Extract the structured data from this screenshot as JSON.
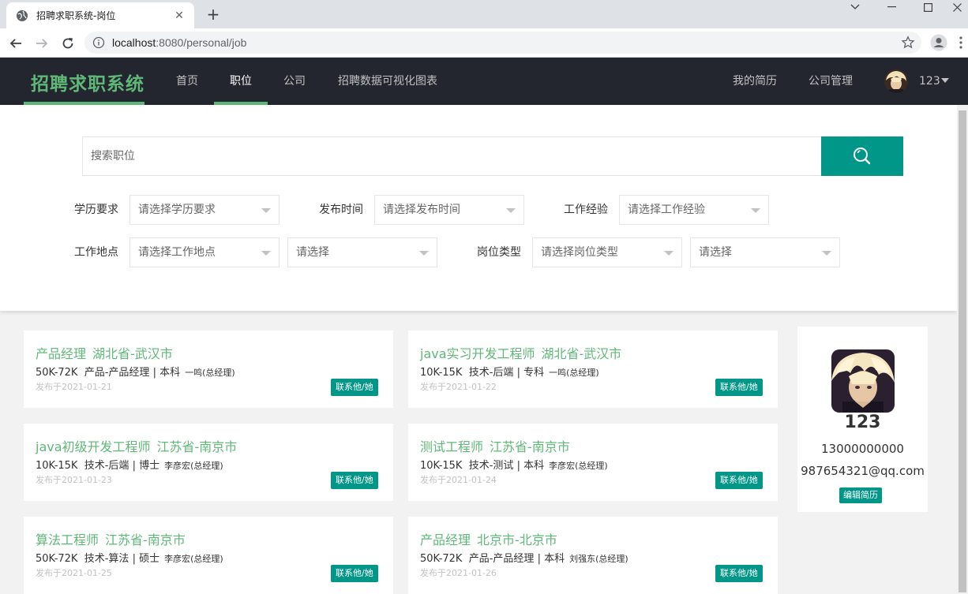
{
  "browser": {
    "tab_title": "招聘求职系统-岗位",
    "tab_close": "✕",
    "new_tab": "+",
    "url_host": "localhost",
    "url_rest": ":8080/personal/job"
  },
  "header": {
    "logo": "招聘求职系统",
    "nav": [
      "首页",
      "职位",
      "公司",
      "招聘数据可视化图表"
    ],
    "active_nav": "职位",
    "my_resume": "我的简历",
    "company_admin": "公司管理",
    "username": "123"
  },
  "search": {
    "placeholder": "搜索职位",
    "filters": {
      "education_label": "学历要求",
      "education_placeholder": "请选择学历要求",
      "publish_time_label": "发布时间",
      "publish_time_placeholder": "请选择发布时间",
      "experience_label": "工作经验",
      "experience_placeholder": "请选择工作经验",
      "location_label": "工作地点",
      "location_placeholder": "请选择工作地点",
      "location_sub_placeholder": "请选择",
      "job_type_label": "岗位类型",
      "job_type_placeholder": "请选择岗位类型",
      "job_type_sub_placeholder": "请选择"
    }
  },
  "jobs": [
    {
      "title": "产品经理",
      "city": "湖北省-武汉市",
      "salary": "50K-72K",
      "category": "产品-产品经理",
      "education": "本科",
      "hr": "一鸣(总经理)",
      "date": "发布于2021-01-21",
      "contact": "联系他/她"
    },
    {
      "title": "java实习开发工程师",
      "city": "湖北省-武汉市",
      "salary": "10K-15K",
      "category": "技术-后端",
      "education": "专科",
      "hr": "一鸣(总经理)",
      "date": "发布于2021-01-22",
      "contact": "联系他/她"
    },
    {
      "title": "java初级开发工程师",
      "city": "江苏省-南京市",
      "salary": "10K-15K",
      "category": "技术-后端",
      "education": "博士",
      "hr": "李彦宏(总经理)",
      "date": "发布于2021-01-23",
      "contact": "联系他/她"
    },
    {
      "title": "测试工程师",
      "city": "江苏省-南京市",
      "salary": "10K-15K",
      "category": "技术-测试",
      "education": "本科",
      "hr": "李彦宏(总经理)",
      "date": "发布于2021-01-24",
      "contact": "联系他/她"
    },
    {
      "title": "算法工程师",
      "city": "江苏省-南京市",
      "salary": "50K-72K",
      "category": "技术-算法",
      "education": "硕士",
      "hr": "李彦宏(总经理)",
      "date": "发布于2021-01-25",
      "contact": "联系他/她"
    },
    {
      "title": "产品经理",
      "city": "北京市-北京市",
      "salary": "50K-72K",
      "category": "产品-产品经理",
      "education": "本科",
      "hr": "刘强东(总经理)",
      "date": "发布于2021-01-26",
      "contact": "联系他/她"
    }
  ],
  "profile": {
    "name": "123",
    "phone": "13000000000",
    "email": "987654321@qq.com",
    "edit_resume": "编辑简历"
  },
  "colors": {
    "accent_green": "#5fb878",
    "button_teal": "#009688",
    "header_bg": "#23262e"
  }
}
